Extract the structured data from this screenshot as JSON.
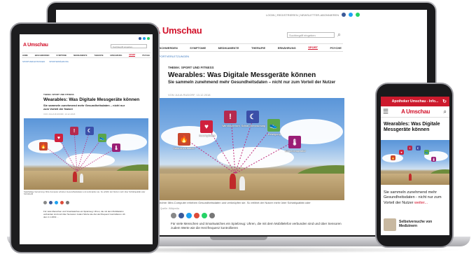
{
  "laptop": {
    "top_links": "LOGIN | REGISTRIEREN | NEWSLETTER-ABONNIEREN",
    "logo": "A Umschau",
    "search_placeholder": "Suchbegriff eingeben",
    "nav": [
      "BESCHWERDEN",
      "SYMPTOME",
      "MEDIKAMENTE",
      "THERAPIE",
      "ERNÄHRUNG",
      "SPORT",
      "PSYCHE"
    ],
    "active_nav": "SPORT",
    "subnav": "SPORTVERLETZUNGEN",
    "kicker": "THEMA: SPORT UND FITNESS",
    "title": "Wearables: Was Digitale Messgeräte können",
    "lead": "Sie sammeln zunehmend mehr Gesundheitsdaten – nicht nur zum Vorteil der Nutzer",
    "byline": "VON JULIA RUDORF, 13.12.2018",
    "tiles": [
      {
        "label": "Herzrhythmus",
        "color": "#d0213d",
        "glyph": "♥"
      },
      {
        "label": "Warnhinweisen",
        "color": "#b52a4e",
        "glyph": "!"
      },
      {
        "label": "Schlaf-überwachung",
        "color": "#3b4fa8",
        "glyph": "☾"
      },
      {
        "label": "Bewegung",
        "color": "#5aa64a",
        "glyph": "👟"
      },
      {
        "label": "Körpertemperatur",
        "color": "#9a1e76",
        "glyph": "🌡"
      },
      {
        "label": "Kalorienverbrauch",
        "color": "#c9472d",
        "glyph": "🔥"
      }
    ],
    "caption": "Bildrechte: Mini-Computer erheben Gesundheitsdaten und verknüpfen sie. So erfährt der Nutzer mehr über Schlafqualität oder",
    "caption_small": "Lauf, Quelle: Wikipedia",
    "body": "Für viele Menschen und Smartwatches ein Spielzeug: Uhren, die mit dem Mobiltelefon verbunden sind und über Sensoren zudem Werte wie die Herzfrequenz kontrollieren"
  },
  "tablet": {
    "logo": "A Umschau",
    "search_placeholder": "Suchbegriff eingeben",
    "nav": [
      "HOME",
      "BESCHWERDEN",
      "SYMPTOME",
      "MEDIKAMENTE",
      "THERAPIE",
      "ERNÄHRUNG",
      "SPORT",
      "PSYCHE"
    ],
    "active_nav": "SPORT",
    "subnav": [
      "SPORTVERLETZUNGEN",
      "SPORTERNÄHRUNG"
    ],
    "kicker": "THEMA: SPORT UND FITNESS",
    "title": "Wearables: Was Digitale Messgeräte können",
    "lead": "Sie sammeln zunehmend mehr Gesundheitsdaten – nicht nur zum Vorteil der Nutzer",
    "byline": "VON JULIA RUDORF, 13.12.2018",
    "caption": "Spielhaltige Vernetzung: Mini-Computer erheben Gesundheitsdaten und verknüpfen sie. So erfährt der Nutzer mehr über Schlafqualität oder Schrittzahl",
    "body": "Für viele Menschen und Smartwatches ein Spielzeug: Uhren, die mit dem Mobiltelefon verbunden sind und über Sensoren zudem Werte wie die Herzfrequenz kontrollieren. Ab dem 1.1.2019 ..."
  },
  "phone": {
    "app_title": "Apotheker Umschau - Info...",
    "logo": "A Umschau",
    "title": "Wearables: Was Digitale Messgeräte können",
    "lead_a": "Sie sammeln zunehmend mehr Gesundheitsdaten - nicht nur zum Vorteil der Nutzer ",
    "lead_more": "weiter...",
    "teaser": "Selbstversuche von Medizinern"
  }
}
